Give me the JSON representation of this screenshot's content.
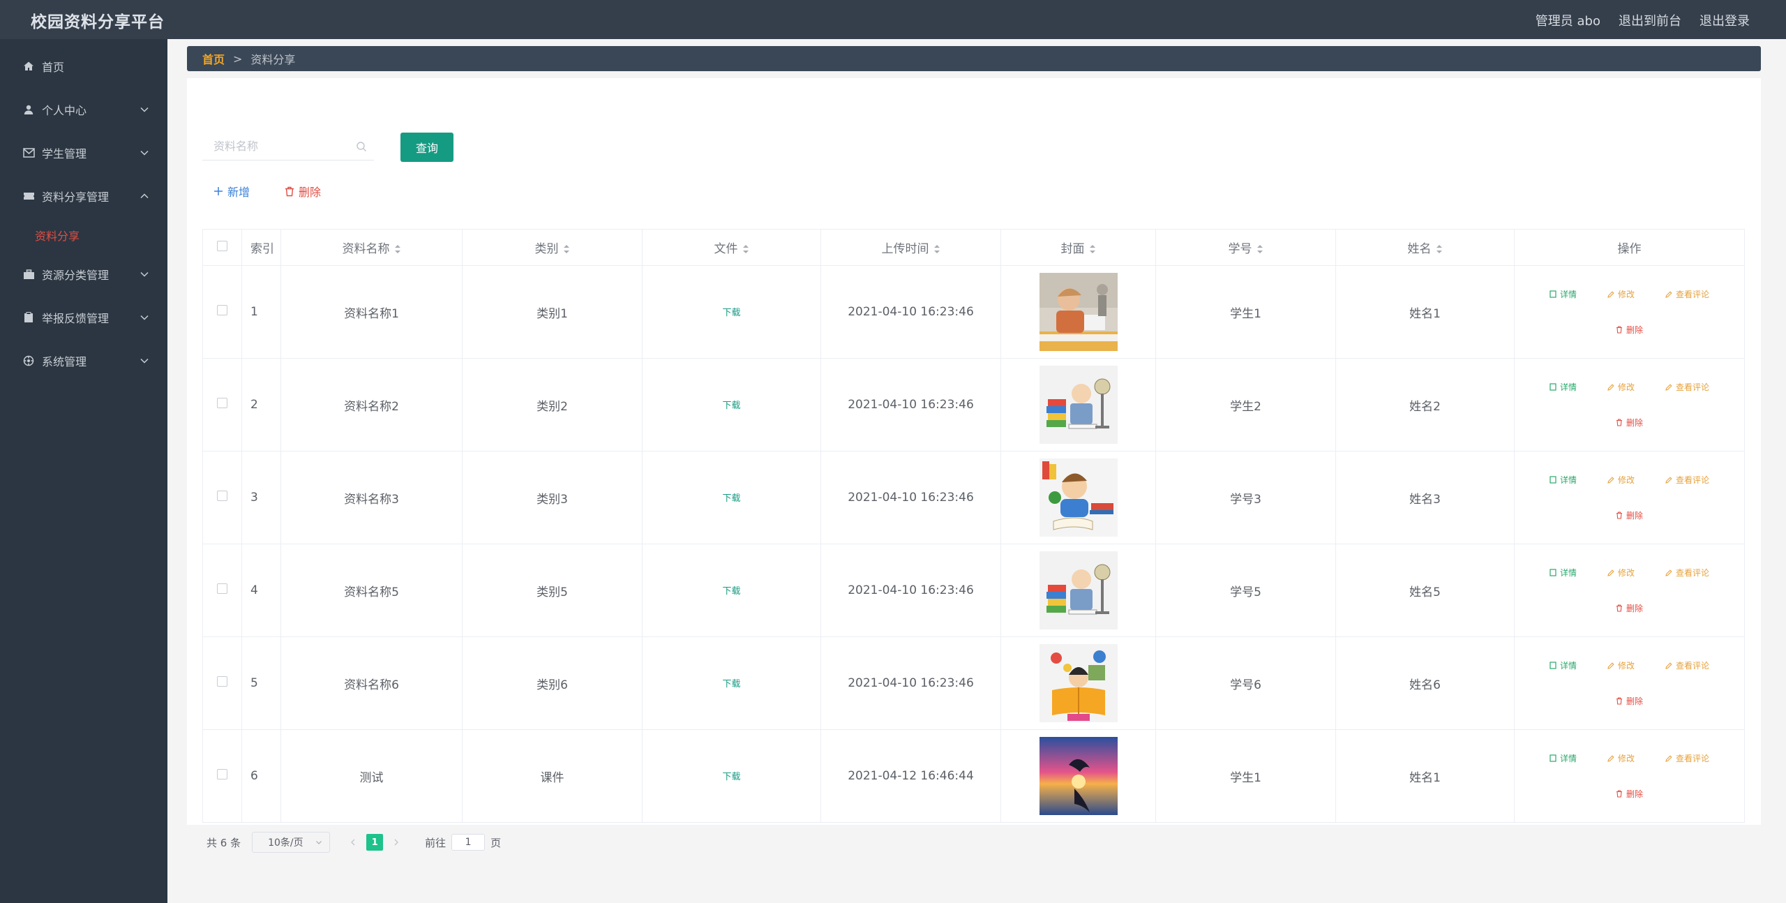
{
  "header": {
    "title": "校园资料分享平台",
    "user_label": "管理员 abo",
    "front_link": "退出到前台",
    "logout_link": "退出登录"
  },
  "sidebar": {
    "items": [
      {
        "label": "首页",
        "icon": "home-icon"
      },
      {
        "label": "个人中心",
        "icon": "user-icon"
      },
      {
        "label": "学生管理",
        "icon": "mail-icon"
      },
      {
        "label": "资料分享管理",
        "icon": "ticket-icon"
      },
      {
        "label": "资源分类管理",
        "icon": "briefcase-icon"
      },
      {
        "label": "举报反馈管理",
        "icon": "clipboard-icon"
      },
      {
        "label": "系统管理",
        "icon": "settings-icon"
      }
    ],
    "active_sub": "资料分享"
  },
  "breadcrumb": {
    "home": "首页",
    "separator": ">",
    "current": "资料分享"
  },
  "search": {
    "placeholder": "资料名称",
    "value": "",
    "button": "查询"
  },
  "actions": {
    "add": "新增",
    "delete": "删除"
  },
  "table": {
    "headers": {
      "index": "索引",
      "name": "资料名称",
      "category": "类别",
      "file": "文件",
      "upload_time": "上传时间",
      "cover": "封面",
      "student_no": "学号",
      "student_name": "姓名",
      "ops": "操作"
    },
    "rows": [
      {
        "index": "1",
        "name": "资料名称1",
        "category": "类别1",
        "file": "下载",
        "time": "2021-04-10 16:23:46",
        "student_no": "学生1",
        "student_name": "姓名1"
      },
      {
        "index": "2",
        "name": "资料名称2",
        "category": "类别2",
        "file": "下载",
        "time": "2021-04-10 16:23:46",
        "student_no": "学生2",
        "student_name": "姓名2"
      },
      {
        "index": "3",
        "name": "资料名称3",
        "category": "类别3",
        "file": "下载",
        "time": "2021-04-10 16:23:46",
        "student_no": "学号3",
        "student_name": "姓名3"
      },
      {
        "index": "4",
        "name": "资料名称5",
        "category": "类别5",
        "file": "下载",
        "time": "2021-04-10 16:23:46",
        "student_no": "学号5",
        "student_name": "姓名5"
      },
      {
        "index": "5",
        "name": "资料名称6",
        "category": "类别6",
        "file": "下载",
        "time": "2021-04-10 16:23:46",
        "student_no": "学号6",
        "student_name": "姓名6"
      },
      {
        "index": "6",
        "name": "测试",
        "category": "课件",
        "file": "下载",
        "time": "2021-04-12 16:46:44",
        "student_no": "学生1",
        "student_name": "姓名1"
      }
    ],
    "ops": {
      "detail": "详情",
      "edit": "修改",
      "comment": "查看评论",
      "delete": "删除"
    }
  },
  "pagination": {
    "total": "共 6 条",
    "page_size": "10条/页",
    "current_page": "1",
    "goto_label": "前往",
    "goto_value": "1",
    "page_suffix": "页"
  },
  "colors": {
    "accent": "#169b83",
    "danger": "#e34d43",
    "warning": "#e6a23c",
    "link": "#3a80d8",
    "sidebar_bg": "#2b3642",
    "header_bg": "#353f4c"
  }
}
